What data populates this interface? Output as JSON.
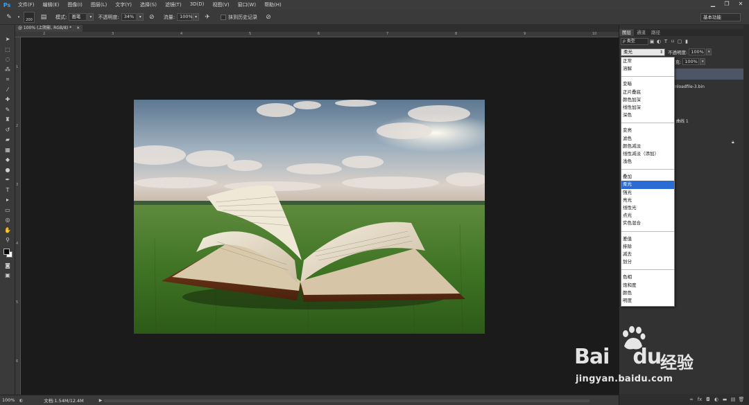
{
  "app": {
    "logo": "Ps"
  },
  "menu": [
    "文件(F)",
    "编辑(E)",
    "图像(I)",
    "图层(L)",
    "文字(Y)",
    "选择(S)",
    "滤镜(T)",
    "3D(D)",
    "视图(V)",
    "窗口(W)",
    "帮助(H)"
  ],
  "window_controls": [
    "▁",
    "❐",
    "✕"
  ],
  "options": {
    "brush_size": "200",
    "mode_label": "模式:",
    "mode_value": "画笔",
    "opacity_label": "不透明度:",
    "opacity_value": "34%",
    "flow_label": "流量:",
    "flow_value": "100%",
    "history_label": "抹到历史记录",
    "workspace": "基本功能"
  },
  "document": {
    "tab_label": "@ 100% (上阴影, RGB/8) *",
    "tab_close": "×",
    "ruler_top": [
      "2",
      "3",
      "4",
      "5",
      "6",
      "7",
      "8",
      "9",
      "10"
    ],
    "ruler_left": [
      "1",
      "2",
      "3",
      "4",
      "5",
      "6"
    ]
  },
  "status": {
    "zoom": "100%",
    "doc_info": "文档:1.54M/12.4M",
    "arrow": "▶"
  },
  "panel": {
    "tabs": [
      "图层",
      "通道",
      "路径"
    ],
    "filter_kind": "ρ 类型",
    "blend_value": "柔光",
    "opacity_label": "不透明度:",
    "opacity_value": "100%",
    "fill_label": "填充:",
    "fill_value": "100%",
    "layer_name_1": "nloadfile-3.bin",
    "layer_name_2": "曲线 1"
  },
  "blend_modes": [
    [
      "正常",
      "溶解"
    ],
    [
      "变暗",
      "正片叠底",
      "颜色加深",
      "线性加深",
      "深色"
    ],
    [
      "变亮",
      "滤色",
      "颜色减淡",
      "线性减淡（添加）",
      "浅色"
    ],
    [
      "叠加",
      "柔光",
      "强光",
      "亮光",
      "线性光",
      "点光",
      "实色混合"
    ],
    [
      "差值",
      "排除",
      "减去",
      "划分"
    ],
    [
      "色相",
      "饱和度",
      "颜色",
      "明度"
    ]
  ],
  "selected_blend": "柔光",
  "watermark": {
    "brand": "Bai",
    "brand_suffix": "du",
    "cn": "经验",
    "url": "jingyan.baidu.com"
  },
  "colors": {
    "accent_selected": "#2a6bd4",
    "ps_blue": "#31a8ff",
    "foreground": "#000000",
    "background": "#ffffff"
  }
}
